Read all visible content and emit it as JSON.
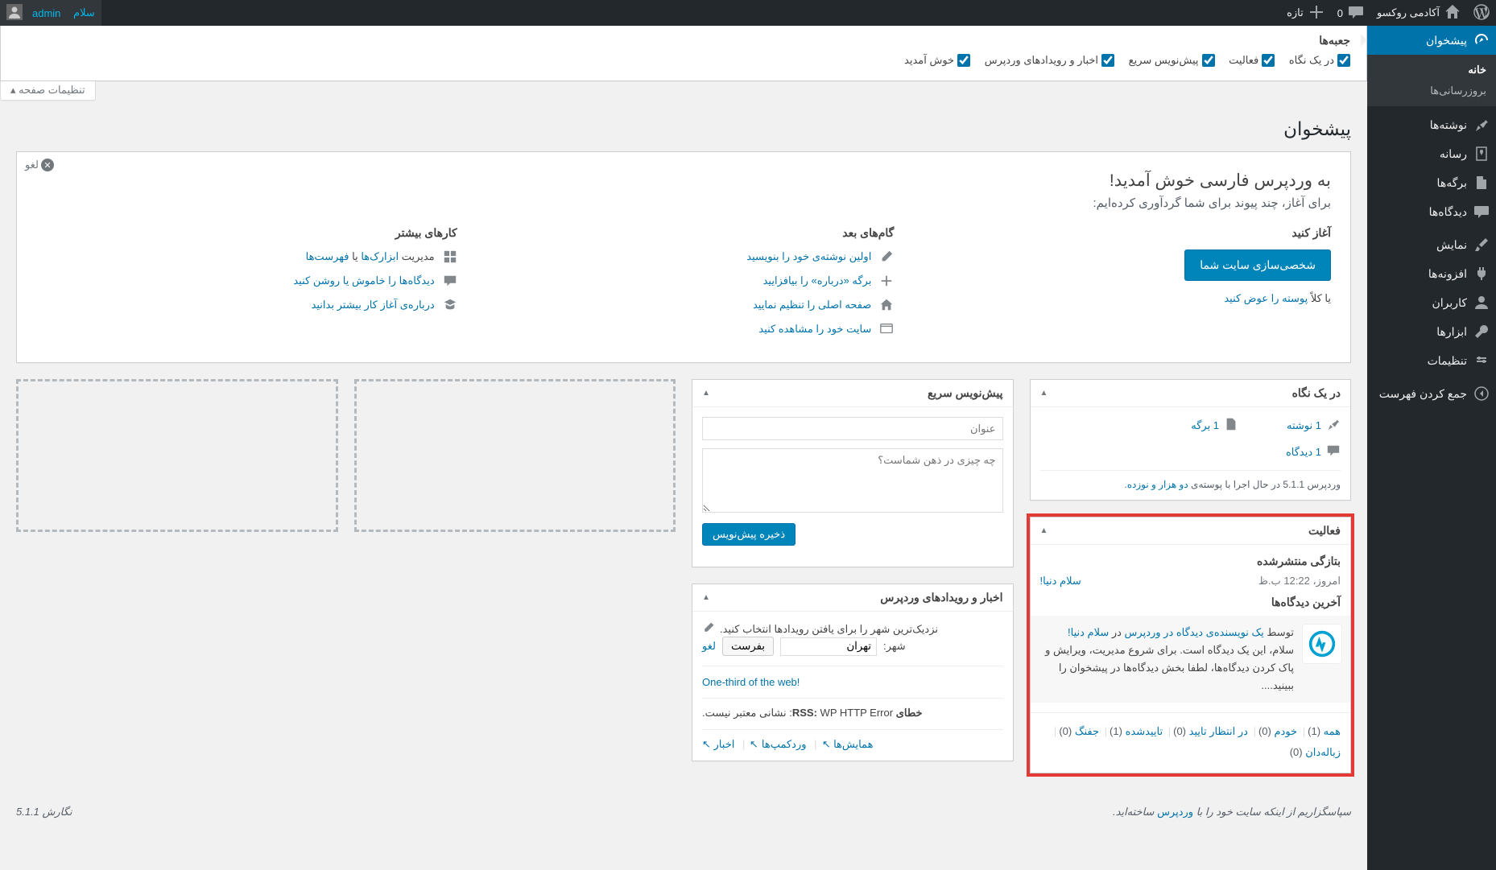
{
  "adminbar": {
    "site_name": "آکادمی روکسو",
    "comments_count": "0",
    "new_label": "تازه",
    "greeting": "سلام",
    "username": "admin"
  },
  "menu": {
    "dashboard": "پیشخوان",
    "home": "خانه",
    "updates": "بروزرسانی‌ها",
    "posts": "نوشته‌ها",
    "media": "رسانه",
    "pages": "برگه‌ها",
    "comments": "دیدگاه‌ها",
    "appearance": "نمایش",
    "plugins": "افزونه‌ها",
    "users": "کاربران",
    "tools": "ابزارها",
    "settings": "تنظیمات",
    "collapse": "جمع کردن فهرست"
  },
  "screen_options": {
    "tab": "تنظیمات صفحه",
    "heading": "جعبه‌ها",
    "opts": {
      "glance": "در یک نگاه",
      "activity": "فعالیت",
      "quickdraft": "پیش‌نویس سریع",
      "news": "اخبار و رویدادهای وردپرس",
      "welcome": "خوش آمدید"
    }
  },
  "page_title": "پیشخوان",
  "welcome": {
    "dismiss": "لغو",
    "heading": "به وردپرس فارسی خوش آمدید!",
    "sub": "برای آغاز، چند پیوند برای شما گردآوری کرده‌ایم:",
    "col_start": {
      "h": "آغاز کنید",
      "btn": "شخصی‌سازی سایت شما",
      "or": "یا کلاً",
      "theme_link": "پوسته را عوض کنید"
    },
    "col_next": {
      "h": "گام‌های بعد",
      "a": "اولین نوشته‌ی خود را بنویسید",
      "b": "برگه «درباره» را بیافزایید",
      "c": "صفحه اصلی را تنظیم نمایید",
      "d": "سایت خود را مشاهده کنید"
    },
    "col_more": {
      "h": "کارهای بیشتر",
      "a_pre": "مدیریت",
      "a1": "ابزارک‌ها",
      "a_mid": "یا",
      "a2": "فهرست‌ها",
      "b": "دیدگاه‌ها را خاموش یا روشن کنید",
      "c": "درباره‌ی آغاز کار بیشتر بدانید"
    }
  },
  "glance": {
    "title": "در یک نگاه",
    "posts": "1 نوشته",
    "pages": "1 برگه",
    "comments": "1 دیدگاه",
    "version_pre": "وردپرس 5.1.1 در حال اجرا با پوسته‌ی",
    "theme": "دو هزار و نوزده"
  },
  "activity": {
    "title": "فعالیت",
    "recent_h": "بتازگی منتشرشده",
    "time": "امروز، 12:22 ب.ظ",
    "post": "سلام دنیا!",
    "comments_h": "آخرین دیدگاه‌ها",
    "by": "توسط",
    "author": "یک نویسنده‌ی دیدگاه در وردپرس",
    "on": "در",
    "post2": "سلام دنیا!",
    "text": "سلام، این یک دیدگاه است. برای شروع مدیریت، ویرایش و پاک کردن دیدگاه‌ها، لطفا بخش دیدگاه‌ها در پیشخوان را ببینید....",
    "filters": {
      "all": "همه",
      "all_c": "(1)",
      "mine": "خودم",
      "mine_c": "(0)",
      "pending": "در انتظار تایید",
      "pending_c": "(0)",
      "approved": "تاییدشده",
      "approved_c": "(1)",
      "spam": "جفنگ",
      "spam_c": "(0)",
      "trash": "زباله‌دان",
      "trash_c": "(0)"
    }
  },
  "quickdraft": {
    "title": "پیش‌نویس سریع",
    "title_ph": "عنوان",
    "content_ph": "چه چیزی در ذهن شماست؟",
    "save": "ذخیره پیش‌نویس"
  },
  "news": {
    "title": "اخبار و رویدادهای وردپرس",
    "prompt": "نزدیک‌ترین شهر را برای یافتن رویدادها انتخاب کنید.",
    "city_label": "شهر:",
    "city_value": "تهران",
    "submit": "بفرست",
    "cancel": "لغو",
    "onethird": "!One-third of the web",
    "err_lbl": "خطای RSS:",
    "err_txt": "WP HTTP Error: نشانی معتبر نیست.",
    "meetups": "همایش‌ها",
    "wordcamps": "وردکمپ‌ها",
    "news_link": "اخبار"
  },
  "footer": {
    "thanks_pre": "سپاسگزاریم از اینکه سایت خود را با",
    "wp": "وردپرس",
    "thanks_post": "ساخته‌اید.",
    "version": "نگارش 5.1.1"
  }
}
